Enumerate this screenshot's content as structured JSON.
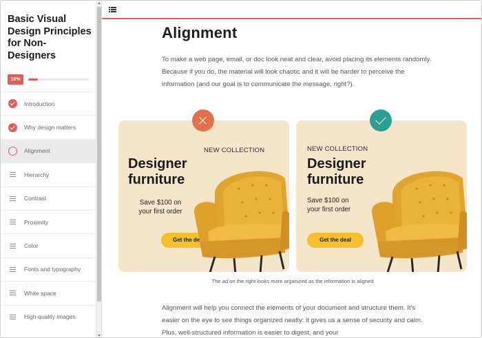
{
  "sidebar": {
    "course_title": "Basic Visual Design Principles for Non-Designers",
    "progress": {
      "label": "16%",
      "fraction": 0.16,
      "accent": "#e25c5c"
    },
    "items": [
      {
        "label": "Introduction",
        "state": "completed",
        "icon": "check-circle-icon"
      },
      {
        "label": "Why design matters",
        "state": "completed",
        "icon": "check-circle-icon"
      },
      {
        "label": "Alignment",
        "state": "current",
        "icon": "ring-icon"
      },
      {
        "label": "Hierarchy",
        "state": "pending",
        "icon": "lines-icon"
      },
      {
        "label": "Contrast",
        "state": "pending",
        "icon": "lines-icon"
      },
      {
        "label": "Proximity",
        "state": "pending",
        "icon": "lines-icon"
      },
      {
        "label": "Color",
        "state": "pending",
        "icon": "lines-icon"
      },
      {
        "label": "Fonts and typography",
        "state": "pending",
        "icon": "lines-icon"
      },
      {
        "label": "White space",
        "state": "pending",
        "icon": "lines-icon"
      },
      {
        "label": "High-quality images",
        "state": "pending",
        "icon": "lines-icon"
      }
    ]
  },
  "topbar": {
    "menu_icon": "list-menu-icon"
  },
  "content": {
    "title": "Alignment",
    "intro": "To make a web page, email, or doc look neat and clear, avoid placing its elements randomly. Because if you do, the material will look chaotic and it will be harder to perceive the information (and our goal is to communicate the message, right?).",
    "ads": {
      "bad": {
        "badge_icon": "cross-icon",
        "badge_color": "#e07148",
        "tag": "NEW COLLECTION",
        "headline_1": "Designer",
        "headline_2": "furniture",
        "offer_1": "Save $100 on",
        "offer_2": "your first order",
        "cta": "Get the deal"
      },
      "good": {
        "badge_icon": "check-icon",
        "badge_color": "#2aa093",
        "tag": "NEW COLLECTION",
        "headline_1": "Designer",
        "headline_2": "furniture",
        "offer_1": "Save $100 on",
        "offer_2": "your first order",
        "cta": "Get the deal"
      },
      "card_color": "#f5e5c9",
      "cta_color": "#f4c02d"
    },
    "caption": "The ad on the right looks more organized as the information is aligned",
    "body": "Alignment will help you connect the elements of your document and structure them. It's easier on the eye to see things organized neatly: it gives us a sense of security and calm. Plus, well-structured information is easier to digest, and your"
  }
}
